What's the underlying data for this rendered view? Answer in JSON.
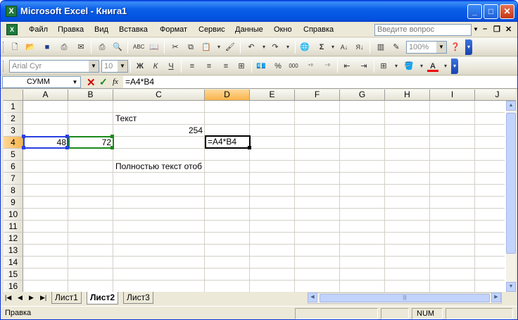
{
  "window": {
    "title": "Microsoft Excel - Книга1",
    "app_icon": "X"
  },
  "menu": {
    "items": [
      "Файл",
      "Правка",
      "Вид",
      "Вставка",
      "Формат",
      "Сервис",
      "Данные",
      "Окно",
      "Справка"
    ],
    "ask_placeholder": "Введите вопрос"
  },
  "toolbar": {
    "font": "Arial Cyr",
    "size": "10",
    "zoom": "100%",
    "sigma": "Σ",
    "bold": "Ж",
    "italic": "К",
    "underline": "Ч",
    "percent": "%",
    "thousands": "000"
  },
  "formula_bar": {
    "name_box": "СУММ",
    "fx": "fx",
    "formula": "=A4*B4"
  },
  "columns": [
    "A",
    "B",
    "C",
    "D",
    "E",
    "F",
    "G",
    "H",
    "I",
    "J"
  ],
  "selected_column": "D",
  "rows": [
    "1",
    "2",
    "3",
    "4",
    "5",
    "6",
    "7",
    "8",
    "9",
    "10",
    "11",
    "12",
    "13",
    "14",
    "15",
    "16"
  ],
  "cells": {
    "C2": "Текст",
    "C3": "254",
    "A4": "48",
    "B4": "72",
    "D4": "=A4*B4",
    "C6": "Полностью текст отоб"
  },
  "sheets": [
    "Лист1",
    "Лист2",
    "Лист3"
  ],
  "active_sheet": "Лист2",
  "status": {
    "mode": "Правка",
    "num": "NUM"
  }
}
